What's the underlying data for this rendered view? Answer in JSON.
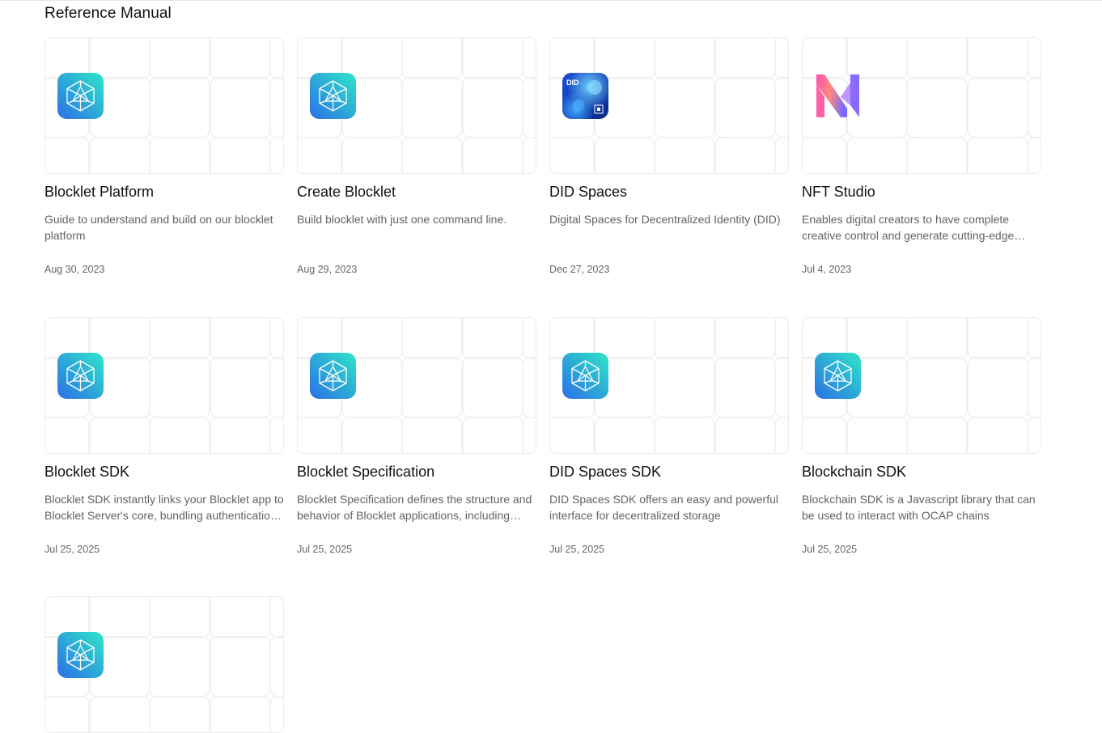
{
  "section": {
    "title": "Reference Manual"
  },
  "cards": [
    {
      "title": "Blocklet Platform",
      "description": "Guide to understand and build on our blocklet platform",
      "date": "Aug 30, 2023",
      "icon": "blocklet-icon"
    },
    {
      "title": "Create Blocklet",
      "description": "Build blocklet with just one command line.",
      "date": "Aug 29, 2023",
      "icon": "blocklet-icon"
    },
    {
      "title": "DID Spaces",
      "description": "Digital Spaces for Decentralized Identity (DID)",
      "date": "Dec 27, 2023",
      "icon": "did-spaces-icon",
      "icon_text": "DID"
    },
    {
      "title": "NFT Studio",
      "description": "Enables digital creators to have complete creative control and generate cutting-edge NFTs",
      "date": "Jul 4, 2023",
      "icon": "nft-studio-icon"
    },
    {
      "title": "Blocklet SDK",
      "description": "Blocklet SDK instantly links your Blocklet app to Blocklet Server's core, bundling authentication and more",
      "date": "Jul 25, 2025",
      "icon": "blocklet-icon"
    },
    {
      "title": "Blocklet Specification",
      "description": "Blocklet Specification defines the structure and behavior of Blocklet applications, including metadata",
      "date": "Jul 25, 2025",
      "icon": "blocklet-icon"
    },
    {
      "title": "DID Spaces SDK",
      "description": "DID Spaces SDK offers an easy and powerful interface for decentralized storage",
      "date": "Jul 25, 2025",
      "icon": "blocklet-icon"
    },
    {
      "title": "Blockchain SDK",
      "description": "Blockchain SDK is a Javascript library that can be used to interact with OCAP chains",
      "date": "Jul 25, 2025",
      "icon": "blocklet-icon"
    },
    {
      "title": "",
      "description": "",
      "date": "",
      "icon": "blocklet-icon"
    }
  ],
  "colors": {
    "brand_teal": "#2ee6c8",
    "brand_blue": "#2b6fe6",
    "text_primary": "#111111",
    "text_secondary": "#5f6368"
  }
}
